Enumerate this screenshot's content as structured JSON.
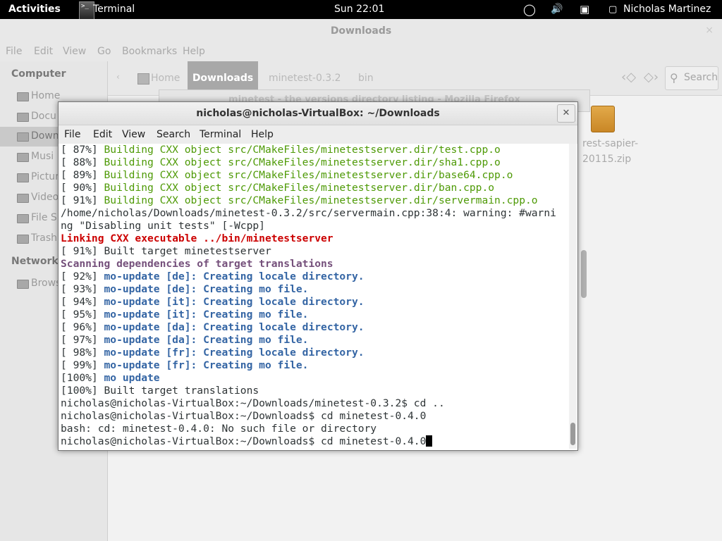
{
  "topbar": {
    "activities": "Activities",
    "app_icon_glyph": ">_",
    "app_name": "Terminal",
    "clock": "Sun 22:01",
    "user": "Nicholas Martinez",
    "icons": [
      "accessibility-icon",
      "volume-icon",
      "network-icon",
      "user-icon"
    ]
  },
  "file_manager": {
    "title": "Downloads",
    "close_glyph": "×",
    "menu": [
      "File",
      "Edit",
      "View",
      "Go",
      "Bookmarks",
      "Help"
    ],
    "sidebar": {
      "section_computer": "Computer",
      "items": [
        "Home",
        "Docu",
        "Down",
        "Musi",
        "Pictur",
        "Video",
        "File S",
        "Trash"
      ],
      "selected": "Down",
      "section_network": "Network",
      "network_items": [
        "Brows"
      ]
    },
    "path": {
      "back_glyph": "‹",
      "crumbs": [
        "Home",
        "Downloads",
        "minetest-0.3.2",
        "bin"
      ],
      "active": "Downloads"
    },
    "nav": {
      "back_glyph": "‹◇",
      "forward_glyph": "◇›"
    },
    "search_label": "Search",
    "files": [
      {
        "name_line1": "rest-sapier-",
        "name_line2": "20115.zip"
      }
    ],
    "background_window_title": "minetest - the versions directory listing - Mozilla Firefox"
  },
  "terminal": {
    "title": "nicholas@nicholas-VirtualBox: ~/Downloads",
    "close_glyph": "✕",
    "menu": [
      "File",
      "Edit",
      "View",
      "Search",
      "Terminal",
      "Help"
    ],
    "lines": [
      {
        "prefix": "[ 87%] ",
        "text": "Building CXX object src/CMakeFiles/minetestserver.dir/test.cpp.o",
        "style": "g"
      },
      {
        "prefix": "[ 88%] ",
        "text": "Building CXX object src/CMakeFiles/minetestserver.dir/sha1.cpp.o",
        "style": "g"
      },
      {
        "prefix": "[ 89%] ",
        "text": "Building CXX object src/CMakeFiles/minetestserver.dir/base64.cpp.o",
        "style": "g"
      },
      {
        "prefix": "[ 90%] ",
        "text": "Building CXX object src/CMakeFiles/minetestserver.dir/ban.cpp.o",
        "style": "g"
      },
      {
        "prefix": "[ 91%] ",
        "text": "Building CXX object src/CMakeFiles/minetestserver.dir/servermain.cpp.o",
        "style": "g"
      },
      {
        "prefix": "",
        "text": "/home/nicholas/Downloads/minetest-0.3.2/src/servermain.cpp:38:4: warning: #warni",
        "style": "n"
      },
      {
        "prefix": "",
        "text": "ng \"Disabling unit tests\" [-Wcpp]",
        "style": "n"
      },
      {
        "prefix": "",
        "text": "Linking CXX executable ../bin/minetestserver",
        "style": "red"
      },
      {
        "prefix": "[ 91%] ",
        "text": "Built target minetestserver",
        "style": "n"
      },
      {
        "prefix": "",
        "text": "Scanning dependencies of target translations",
        "style": "p"
      },
      {
        "prefix": "[ 92%] ",
        "text": "mo-update [de]: Creating locale directory.",
        "style": "b"
      },
      {
        "prefix": "[ 93%] ",
        "text": "mo-update [de]: Creating mo file.",
        "style": "b"
      },
      {
        "prefix": "[ 94%] ",
        "text": "mo-update [it]: Creating locale directory.",
        "style": "b"
      },
      {
        "prefix": "[ 95%] ",
        "text": "mo-update [it]: Creating mo file.",
        "style": "b"
      },
      {
        "prefix": "[ 96%] ",
        "text": "mo-update [da]: Creating locale directory.",
        "style": "b"
      },
      {
        "prefix": "[ 97%] ",
        "text": "mo-update [da]: Creating mo file.",
        "style": "b"
      },
      {
        "prefix": "[ 98%] ",
        "text": "mo-update [fr]: Creating locale directory.",
        "style": "b"
      },
      {
        "prefix": "[ 99%] ",
        "text": "mo-update [fr]: Creating mo file.",
        "style": "b"
      },
      {
        "prefix": "[100%] ",
        "text": "mo update",
        "style": "b"
      },
      {
        "prefix": "[100%] ",
        "text": "Built target translations",
        "style": "n"
      },
      {
        "prefix": "",
        "text": "nicholas@nicholas-VirtualBox:~/Downloads/minetest-0.3.2$ cd ..",
        "style": "n"
      },
      {
        "prefix": "",
        "text": "nicholas@nicholas-VirtualBox:~/Downloads$ cd minetest-0.4.0",
        "style": "n"
      },
      {
        "prefix": "",
        "text": "bash: cd: minetest-0.4.0: No such file or directory",
        "style": "n"
      },
      {
        "prefix": "",
        "text": "nicholas@nicholas-VirtualBox:~/Downloads$ cd minetest-0.4.0",
        "style": "n",
        "cursor": true
      }
    ]
  },
  "colors": {
    "topbar_bg": "#000000",
    "terminal_green": "#4e9a06",
    "terminal_blue": "#3465a4",
    "terminal_purple": "#75507b",
    "terminal_red": "#cc0000",
    "selection_bg": "#a8a8a8"
  }
}
